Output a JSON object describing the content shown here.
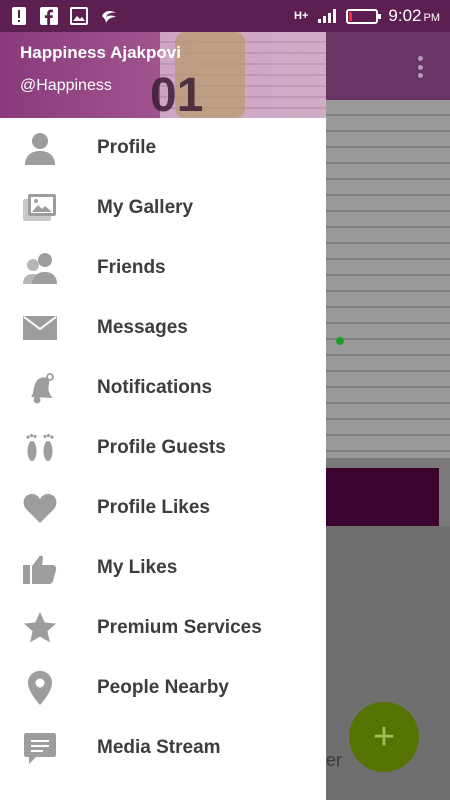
{
  "status_bar": {
    "network": "H+",
    "time": "9:02",
    "ampm": "PM",
    "left_icons": [
      "alert-icon",
      "facebook-icon",
      "image-icon",
      "swiftkey-icon"
    ],
    "battery_level_pct": 10
  },
  "drawer": {
    "header": {
      "name": "Happiness Ajakpovi",
      "handle": "@Happiness"
    },
    "items": [
      {
        "label": "Profile",
        "icon": "person-icon"
      },
      {
        "label": "My Gallery",
        "icon": "gallery-icon"
      },
      {
        "label": "Friends",
        "icon": "friends-icon"
      },
      {
        "label": "Messages",
        "icon": "envelope-icon"
      },
      {
        "label": "Notifications",
        "icon": "bell-icon"
      },
      {
        "label": "Profile Guests",
        "icon": "footprints-icon"
      },
      {
        "label": "Profile Likes",
        "icon": "heart-icon"
      },
      {
        "label": "My Likes",
        "icon": "thumbs-up-icon"
      },
      {
        "label": "Premium Services",
        "icon": "star-icon"
      },
      {
        "label": "People Nearby",
        "icon": "location-pin-icon"
      },
      {
        "label": "Media Stream",
        "icon": "chat-bubble-icon"
      }
    ]
  },
  "background": {
    "fragment_text": "er",
    "header_number": "01"
  },
  "colors": {
    "status_bar": "#5d1f52",
    "accent": "#3c0230",
    "fab": "#547300",
    "icon_gray": "#9d9d9d"
  }
}
